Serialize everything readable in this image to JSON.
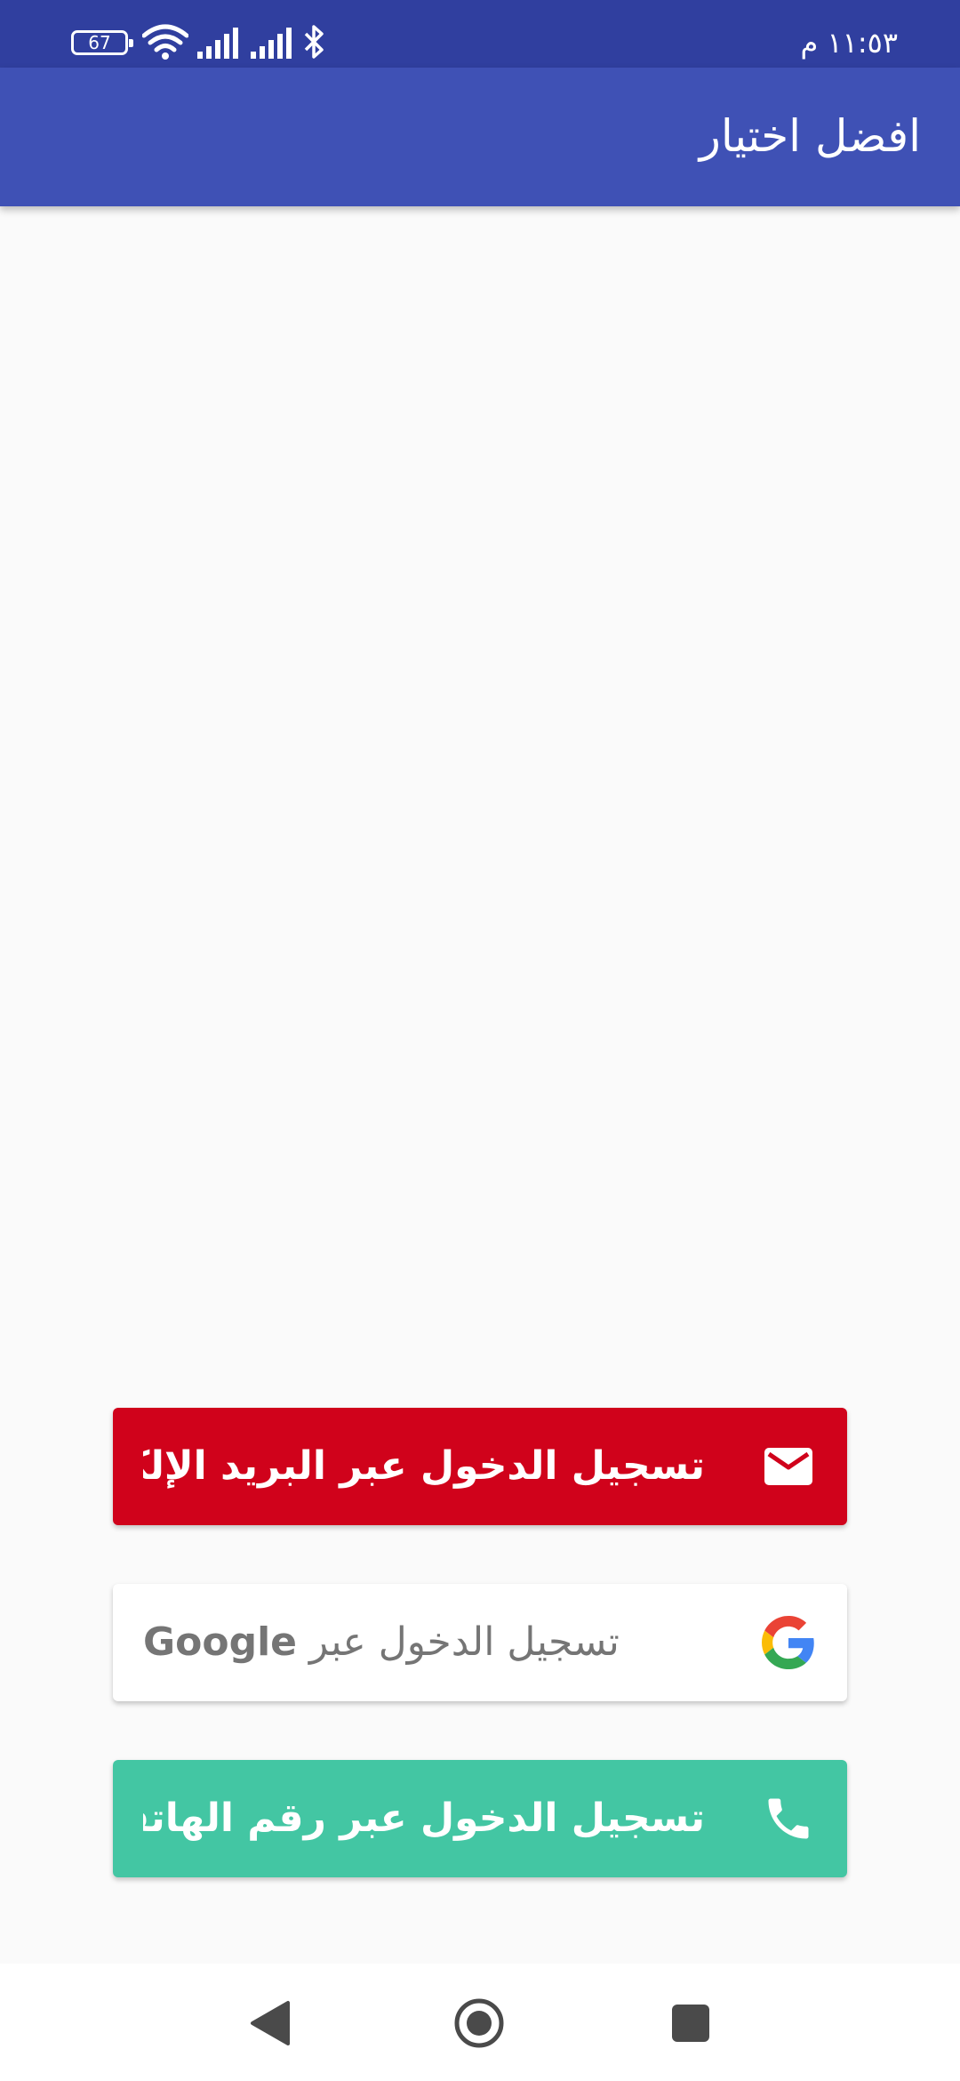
{
  "status_bar": {
    "battery_level": "67",
    "time": "١١:٥٣ م",
    "icons": [
      "battery-icon",
      "wifi-icon",
      "signal-icon",
      "signal-icon",
      "bluetooth-icon"
    ]
  },
  "app_bar": {
    "title": "افضل اختيار"
  },
  "buttons": {
    "email": {
      "label": "تسجيل الدخول عبر البريد الإلكتروني",
      "icon": "mail-icon",
      "color": "#d0021b"
    },
    "google": {
      "label_prefix": "تسجيل الدخول عبر",
      "label_brand": "Google",
      "icon": "google-icon",
      "color": "#ffffff"
    },
    "phone": {
      "label": "تسجيل الدخول عبر رقم الهاتف",
      "icon": "phone-icon",
      "color": "#43c6a3"
    }
  },
  "colors": {
    "status_bar": "#303f9f",
    "app_bar": "#3f51b5",
    "background": "#fafafa"
  },
  "nav_bar": {
    "icons": [
      "back-icon",
      "home-icon",
      "recent-apps-icon"
    ]
  }
}
